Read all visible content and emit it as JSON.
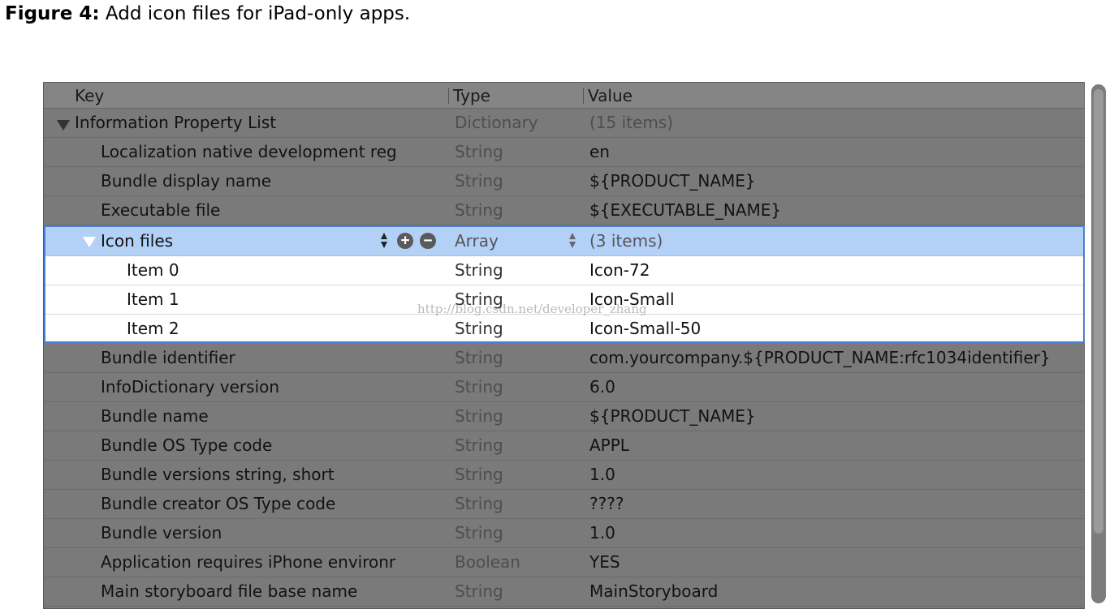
{
  "caption": {
    "figure_number": "Figure 4:",
    "text": "Add icon files for iPad-only apps."
  },
  "plist": {
    "columns": {
      "key": "Key",
      "type": "Type",
      "value": "Value"
    },
    "root": {
      "key": "Information Property List",
      "type": "Dictionary",
      "value": "(15 items)"
    },
    "rows_before": [
      {
        "key": "Localization native development reg",
        "type": "String",
        "value": "en"
      },
      {
        "key": "Bundle display name",
        "type": "String",
        "value": "${PRODUCT_NAME}"
      },
      {
        "key": "Executable file",
        "type": "String",
        "value": "${EXECUTABLE_NAME}"
      }
    ],
    "icon_files": {
      "key": "Icon files",
      "type": "Array",
      "value": "(3 items)",
      "items": [
        {
          "key": "Item 0",
          "type": "String",
          "value": "Icon-72"
        },
        {
          "key": "Item 1",
          "type": "String",
          "value": "Icon-Small"
        },
        {
          "key": "Item 2",
          "type": "String",
          "value": "Icon-Small-50"
        }
      ]
    },
    "rows_after": [
      {
        "key": "Bundle identifier",
        "type": "String",
        "value": "com.yourcompany.${PRODUCT_NAME:rfc1034identifier}"
      },
      {
        "key": "InfoDictionary version",
        "type": "String",
        "value": "6.0"
      },
      {
        "key": "Bundle name",
        "type": "String",
        "value": "${PRODUCT_NAME}"
      },
      {
        "key": "Bundle OS Type code",
        "type": "String",
        "value": "APPL"
      },
      {
        "key": "Bundle versions string, short",
        "type": "String",
        "value": "1.0"
      },
      {
        "key": "Bundle creator OS Type code",
        "type": "String",
        "value": "????"
      },
      {
        "key": "Bundle version",
        "type": "String",
        "value": "1.0"
      },
      {
        "key": "Application requires iPhone environr",
        "type": "Boolean",
        "value": "YES"
      },
      {
        "key": "Main storyboard file base name",
        "type": "String",
        "value": "MainStoryboard"
      }
    ]
  },
  "watermark": "http://blog.csdn.net/developer_zhang",
  "icons": {
    "disclosure": "disclosure-triangle-icon",
    "stepper": "stepper-arrows-icon",
    "add": "plus-circle-icon",
    "remove": "minus-circle-icon"
  },
  "colors": {
    "dimmed_background": "#7a7a7a",
    "selection": "#b3d1f7",
    "highlight_border": "#4d7fd0"
  }
}
